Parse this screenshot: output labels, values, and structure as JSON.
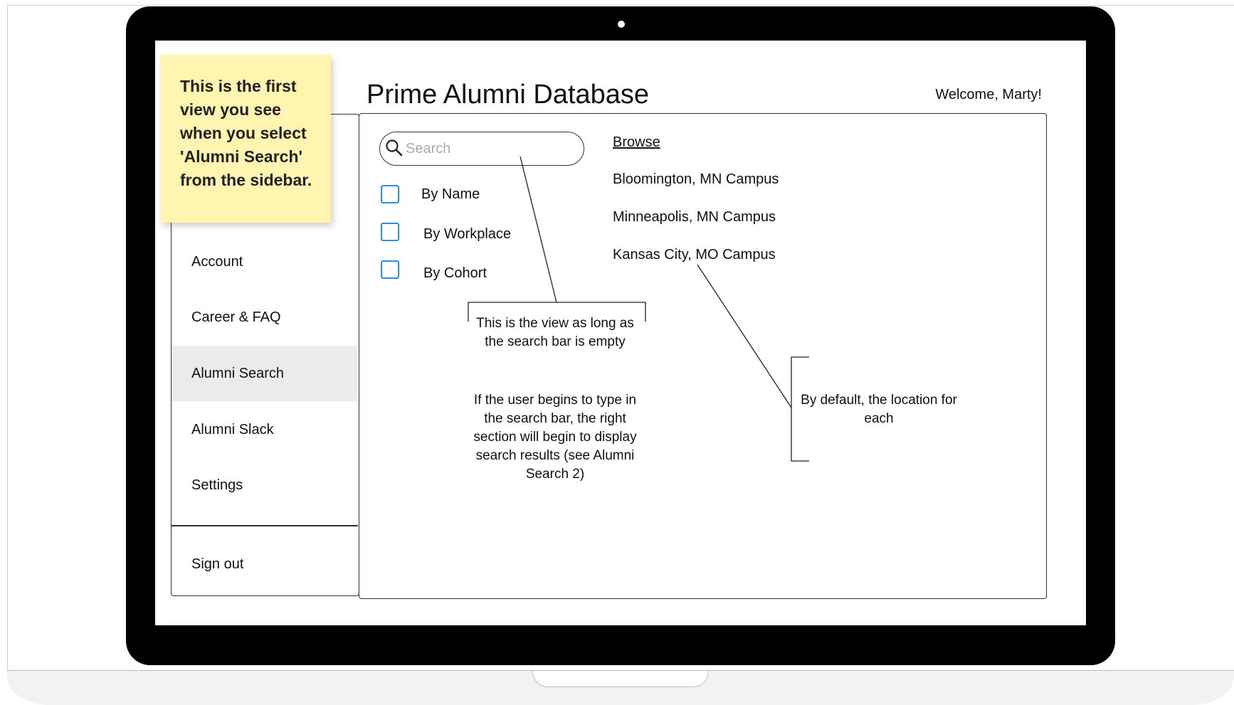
{
  "sticky_note": "This is the first view you see when you select 'Alumni Search' from the sidebar.",
  "header": {
    "title": "Prime Alumni Database",
    "welcome": "Welcome, Marty!"
  },
  "sidebar": {
    "items": [
      {
        "label": "Account",
        "active": false
      },
      {
        "label": "Career & FAQ",
        "active": false
      },
      {
        "label": "Alumni Search",
        "active": true
      },
      {
        "label": "Alumni Slack",
        "active": false
      },
      {
        "label": "Settings",
        "active": false
      }
    ],
    "signout": "Sign out"
  },
  "search": {
    "placeholder": "Search",
    "value": "",
    "filters": [
      {
        "label": "By Name",
        "checked": false
      },
      {
        "label": "By Workplace",
        "checked": false
      },
      {
        "label": "By Cohort",
        "checked": false
      }
    ]
  },
  "browse": {
    "title": "Browse",
    "campuses": [
      "Bloomington, MN Campus",
      "Minneapolis, MN Campus",
      "Kansas City, MO Campus"
    ]
  },
  "annotations": {
    "search_note_1": "This is the view as long as the search bar is empty",
    "search_note_2": "If the user begins to type in the search bar, the right section will begin to display search results (see Alumni Search 2)",
    "location_note": "By default, the location for each"
  },
  "colors": {
    "checkbox_border": "#2e8fdc",
    "sticky_note": "#fff4b0",
    "active_item": "#ebebeb"
  }
}
